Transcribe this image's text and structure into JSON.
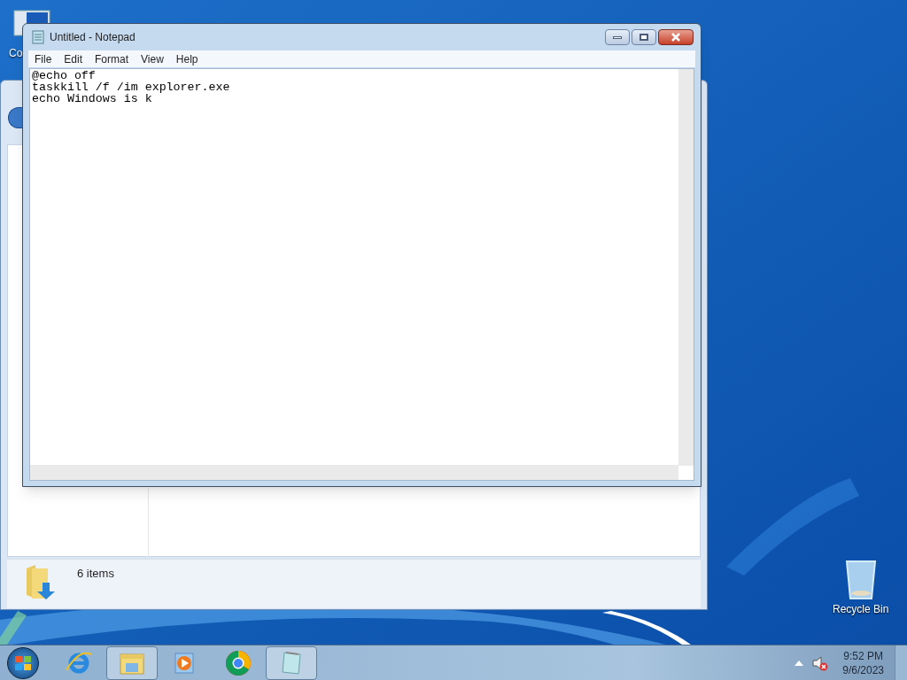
{
  "desktop_icons": [
    {
      "label": "Co",
      "kind": "computer"
    },
    {
      "label": "Recycle Bin",
      "kind": "recycle"
    }
  ],
  "explorer_window": {
    "status_text": "6 items"
  },
  "notepad": {
    "title": "Untitled - Notepad",
    "menu": [
      "File",
      "Edit",
      "Format",
      "View",
      "Help"
    ],
    "lines": [
      "@echo off",
      "taskkill /f /im explorer.exe",
      "echo Windows is k"
    ]
  },
  "taskbar": {
    "apps": [
      {
        "kind": "ie",
        "active": false
      },
      {
        "kind": "explorer",
        "active": true
      },
      {
        "kind": "media",
        "active": false
      },
      {
        "kind": "chrome",
        "active": false
      },
      {
        "kind": "notepad",
        "active": true
      }
    ],
    "time": "9:52 PM",
    "date": "9/6/2023"
  }
}
